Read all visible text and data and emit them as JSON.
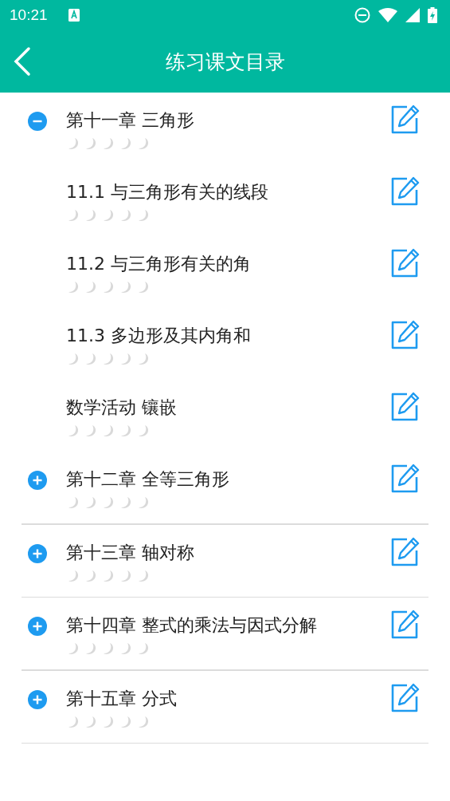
{
  "status_bar": {
    "time": "10:21"
  },
  "header": {
    "title": "练习课文目录"
  },
  "chapters": [
    {
      "title": "第十一章 三角形",
      "stars": 0,
      "expanded": true,
      "children": [
        {
          "title": "11.1 与三角形有关的线段",
          "stars": 0
        },
        {
          "title": "11.2 与三角形有关的角",
          "stars": 0
        },
        {
          "title": "11.3 多边形及其内角和",
          "stars": 0
        },
        {
          "title": "数学活动 镶嵌",
          "stars": 0
        }
      ]
    },
    {
      "title": "第十二章 全等三角形",
      "stars": 0,
      "expanded": false
    },
    {
      "title": "第十三章 轴对称",
      "stars": 0,
      "expanded": false
    },
    {
      "title": "第十四章 整式的乘法与因式分解",
      "stars": 0,
      "expanded": false
    },
    {
      "title": "第十五章 分式",
      "stars": 0,
      "expanded": false
    }
  ]
}
